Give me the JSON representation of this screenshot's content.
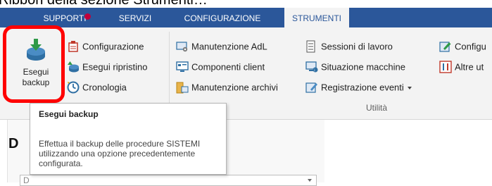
{
  "caption": "Ribbon della sezione Strumenti…",
  "tabs": [
    {
      "label": "SUPPORTI",
      "active": false,
      "has_notification": true
    },
    {
      "label": "SERVIZI",
      "active": false
    },
    {
      "label": "CONFIGURAZIONE",
      "active": false
    },
    {
      "label": "STRUMENTI",
      "active": true
    }
  ],
  "ribbon": {
    "big_button": {
      "label_line1": "Esegui",
      "label_line2": "backup",
      "icon": "backup-icon"
    },
    "backup_group": [
      {
        "label": "Configurazione",
        "icon": "configuration-icon"
      },
      {
        "label": "Esegui ripristino",
        "icon": "restore-icon"
      },
      {
        "label": "Cronologia",
        "icon": "history-icon"
      }
    ],
    "col2": [
      {
        "label": "Manutenzione AdL",
        "icon": "maintenance-adl-icon"
      },
      {
        "label": "Componenti client",
        "icon": "client-components-icon"
      },
      {
        "label": "Manutenzione archivi",
        "icon": "archive-maintenance-icon"
      }
    ],
    "col3": [
      {
        "label": "Sessioni di lavoro",
        "icon": "work-sessions-icon"
      },
      {
        "label": "Situazione macchine",
        "icon": "machines-status-icon"
      },
      {
        "label": "Registrazione eventi",
        "icon": "event-log-icon",
        "dropdown": true
      }
    ],
    "col4": [
      {
        "label": "Configu",
        "icon": "config-edit-icon"
      },
      {
        "label": "Altre ut",
        "icon": "other-tools-icon"
      }
    ],
    "group_label": "Utilità"
  },
  "tooltip": {
    "title": "Esegui backup",
    "body": "Effettua il backup delle procedure SISTEMI utilizzando una opzione precedentemente configurata."
  },
  "content": {
    "heading_initial": "D",
    "field_value": "D"
  },
  "colors": {
    "tab_bar": "#2b579a",
    "ribbon_bg": "#f3f3f3",
    "highlight": "#ff0000",
    "notification": "#c0003b"
  }
}
